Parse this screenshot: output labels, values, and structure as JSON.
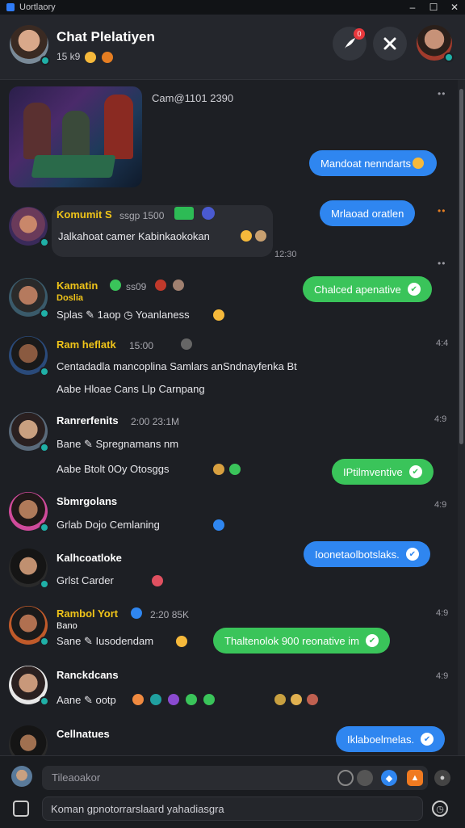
{
  "window": {
    "title": "Uortlaory",
    "controls": [
      "–",
      "☐",
      "✕"
    ]
  },
  "header": {
    "title": "Chat Plelatiyen",
    "subtitle": "15 k9",
    "notification_count": "0"
  },
  "messages": [
    {
      "type": "image",
      "caption": "Cam@1101 2390"
    },
    {
      "type": "outgoing",
      "color": "blue",
      "text": "Mandoat nenndarts"
    },
    {
      "type": "incoming",
      "name": "Komumit S",
      "meta": "ssgp 1500",
      "text": "Jalkahoat camer Kabinkaokokan",
      "time": "12:30"
    },
    {
      "type": "outgoing",
      "color": "blue",
      "text": "Mrlaoad oratlen"
    },
    {
      "type": "incoming",
      "name": "Kamatin",
      "meta": "ss09",
      "sub": "Doslia",
      "text": "Splas ✎ 1aop ◷ Yoanlaness"
    },
    {
      "type": "outgoing",
      "color": "green",
      "text": "Chalced apenative"
    },
    {
      "type": "incoming",
      "name": "Ram heflatk",
      "meta": "15:00",
      "text": "Centadadla mancoplina Samlars anSndnayfenka Bt",
      "text2": "Aabe  Hloae  Cans  Llp Carnpang",
      "time": "4:4"
    },
    {
      "type": "incoming",
      "name": "Ranrerfenits",
      "meta": "2:00 23:1M",
      "text": "Bane ✎ Spregnamans  nm",
      "text2": "Aabe  Btolt  0Oy Otosggs",
      "time": "4:9"
    },
    {
      "type": "outgoing",
      "color": "green",
      "text": "IPtilmventive"
    },
    {
      "type": "incoming",
      "name": "Sbmrgolans",
      "text": "Grlab  Dojo  Cemlaning",
      "time": "4:9"
    },
    {
      "type": "outgoing",
      "color": "blue",
      "text": "Ioonetaolbotslaks."
    },
    {
      "type": "incoming",
      "name": "Kalhcoatloke",
      "text": "Grlst  Carder",
      "time": ""
    },
    {
      "type": "incoming",
      "name": "Rambol Yort",
      "meta": "2:20 85K",
      "sub": "Bano",
      "text": "Sane ✎ Iusodendam",
      "time": "4:9"
    },
    {
      "type": "outgoing",
      "color": "green",
      "text": "Thaltenolok 900 reonative  im"
    },
    {
      "type": "incoming",
      "name": "Ranckdcans",
      "text": "Aane ✎ ootp",
      "time": "4:9"
    },
    {
      "type": "incoming",
      "name": "Cellnatues",
      "text": ""
    },
    {
      "type": "outgoing",
      "color": "blue",
      "text": "Iklaboelmelas."
    }
  ],
  "composer": {
    "placeholder": "Tileaoakor",
    "draft": "Koman gpnotorrarslaard yahadiasgra"
  },
  "colors": {
    "accent_blue": "#2f86f0",
    "accent_green": "#3ac45a",
    "name_yellow": "#f0c419",
    "badge": "#1fb0a7"
  }
}
